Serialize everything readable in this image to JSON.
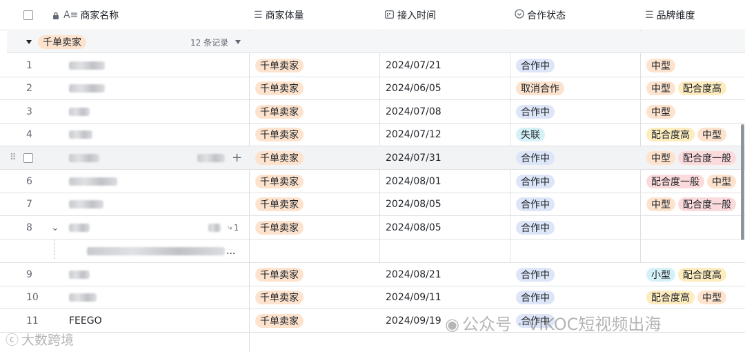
{
  "columns": {
    "name": "商家名称",
    "volume": "商家体量",
    "date": "接入时间",
    "status": "合作状态",
    "brand": "品牌维度"
  },
  "group": {
    "label": "千单卖家",
    "count": "12 条记录"
  },
  "rows": [
    {
      "idx": "1",
      "volume": "千单卖家",
      "date": "2024/07/21",
      "status": "合作中",
      "brand": [
        "中型"
      ]
    },
    {
      "idx": "2",
      "volume": "千单卖家",
      "date": "2024/06/05",
      "status": "取消合作",
      "brand": [
        "中型",
        "配合度高"
      ]
    },
    {
      "idx": "3",
      "volume": "千单卖家",
      "date": "2024/07/08",
      "status": "合作中",
      "brand": [
        "中型"
      ]
    },
    {
      "idx": "4",
      "volume": "千单卖家",
      "date": "2024/07/12",
      "status": "失联",
      "brand": [
        "配合度高",
        "中型"
      ]
    },
    {
      "idx": "",
      "volume": "千单卖家",
      "date": "2024/07/31",
      "status": "合作中",
      "brand": [
        "中型",
        "配合度一般"
      ]
    },
    {
      "idx": "6",
      "volume": "千单卖家",
      "date": "2024/08/01",
      "status": "合作中",
      "brand": [
        "配合度一般",
        "中型"
      ]
    },
    {
      "idx": "7",
      "volume": "千单卖家",
      "date": "2024/08/05",
      "status": "合作中",
      "brand": [
        "中型",
        "配合度一般"
      ]
    },
    {
      "idx": "8",
      "volume": "千单卖家",
      "date": "2024/08/05",
      "status": "合作中",
      "brand": [],
      "subcount": "1"
    },
    {
      "idx": "9",
      "volume": "千单卖家",
      "date": "2024/08/21",
      "status": "合作中",
      "brand": [
        "小型",
        "配合度高"
      ]
    },
    {
      "idx": "10",
      "volume": "千单卖家",
      "date": "2024/09/11",
      "status": "合作中",
      "brand": [
        "配合度高",
        "中型"
      ]
    },
    {
      "idx": "11",
      "name": "FEEGO",
      "volume": "千单卖家",
      "date": "2024/09/19",
      "status": "合作中",
      "brand": []
    }
  ],
  "subrow_ellipsis": "...",
  "watermarks": {
    "left": "大数跨境",
    "right": "公众号 · VIKOC短视频出海"
  },
  "colors": {
    "orange_tag": "#fde3cd",
    "blue_tag": "#dde6f8",
    "cyan_tag": "#d5f1f8",
    "pink_tag": "#fbdadc",
    "yellow_tag": "#fdecbe",
    "border": "#dee0e3"
  }
}
